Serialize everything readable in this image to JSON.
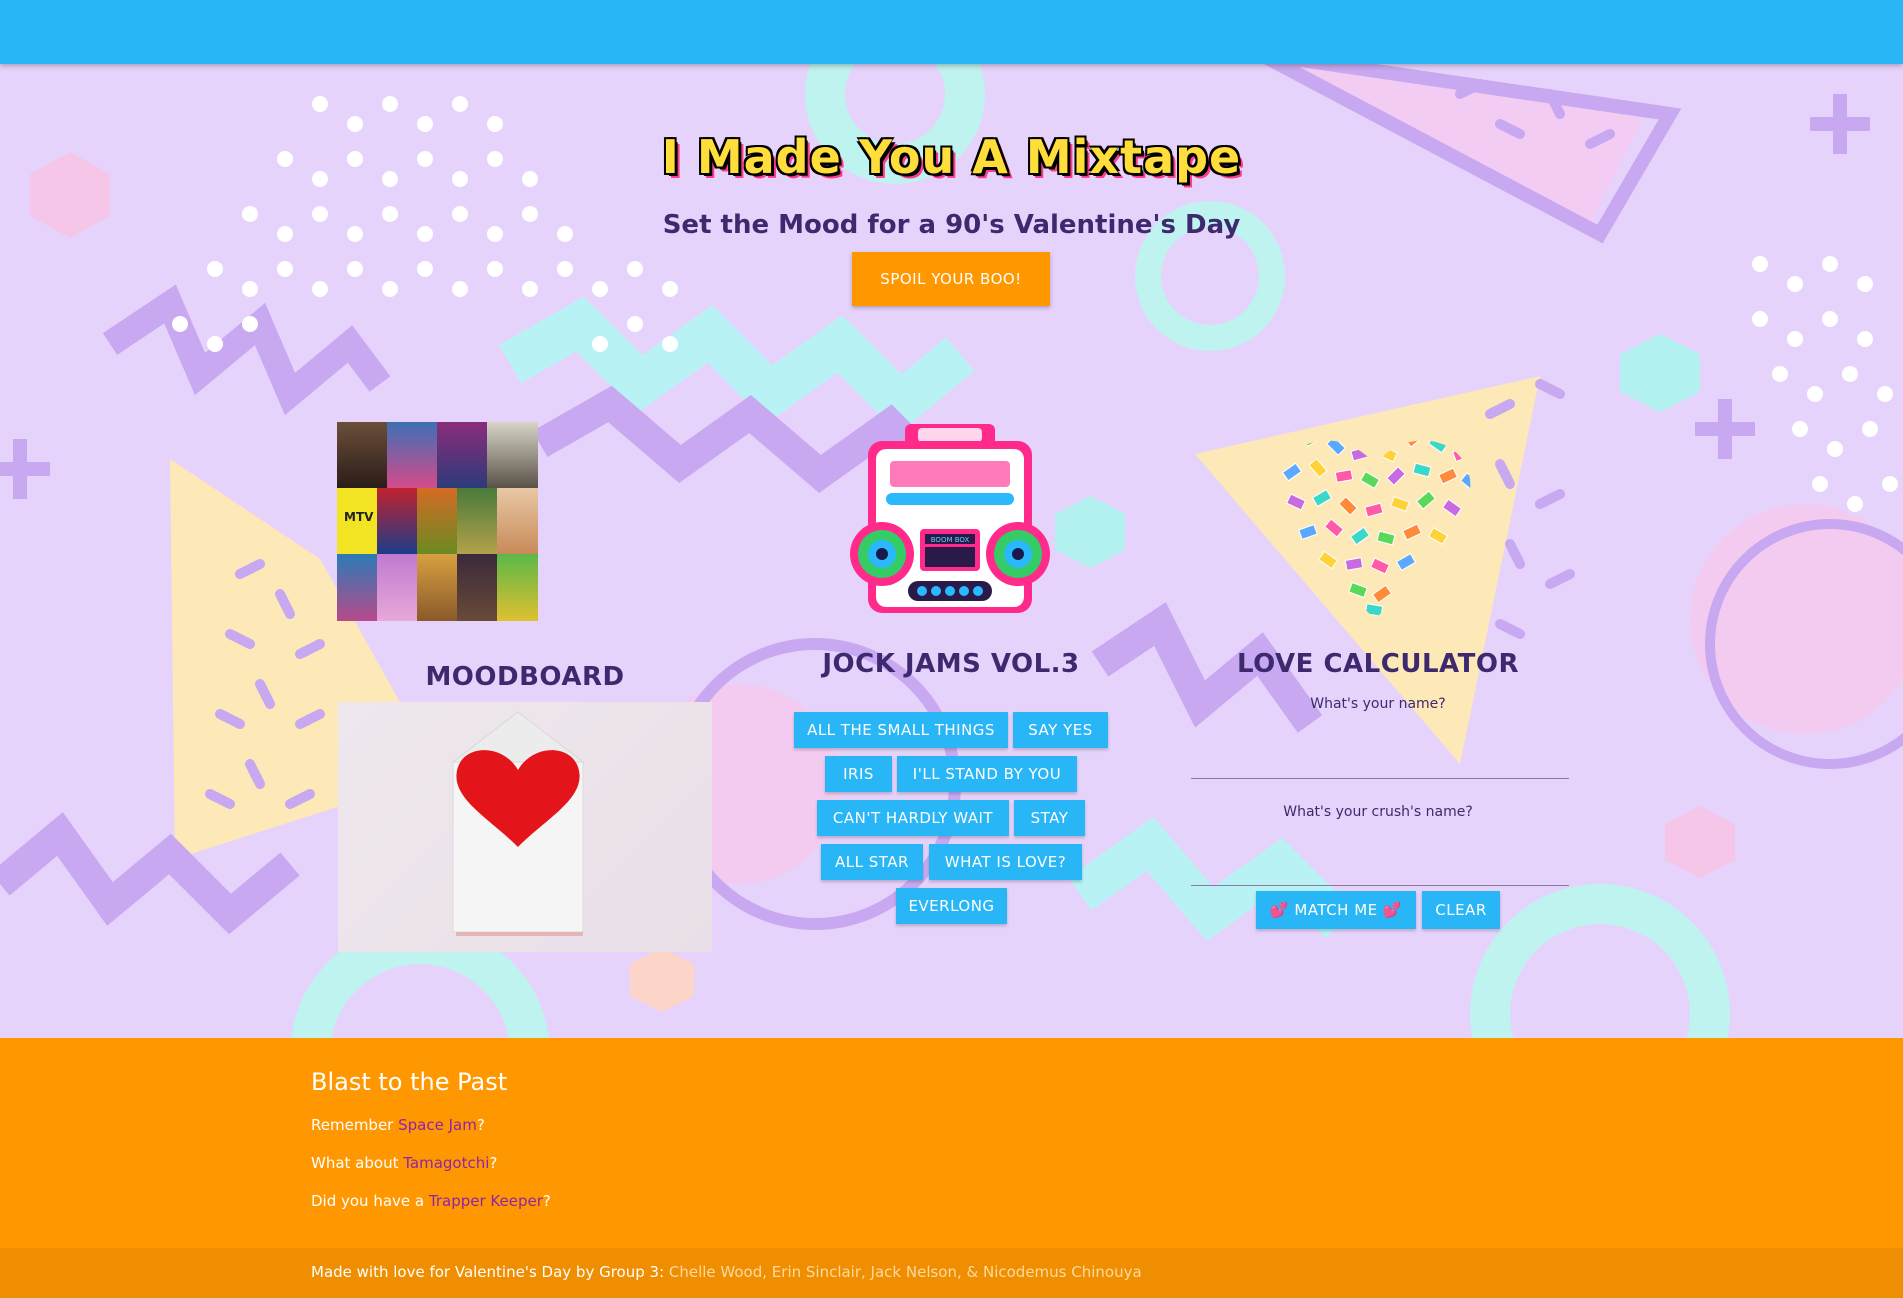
{
  "header": {
    "title": "I Made You A Mixtape",
    "subtitle": "Set the Mood for a 90's Valentine's Day",
    "cta_label": "SPOIL YOUR BOO!"
  },
  "moodboard": {
    "title": "MOODBOARD",
    "collage_label": "MTV"
  },
  "jockjams": {
    "title": "JOCK JAMS VOL.3",
    "boombox_display": "BOOM BOX",
    "songs": [
      "ALL THE SMALL THINGS",
      "SAY YES",
      "IRIS",
      "I'LL STAND BY YOU",
      "CAN'T HARDLY WAIT",
      "STAY",
      "ALL STAR",
      "WHAT IS LOVE?",
      "EVERLONG"
    ]
  },
  "calculator": {
    "title": "LOVE CALCULATOR",
    "name_label": "What's your name?",
    "crush_label": "What's your crush's name?",
    "name_value": "",
    "crush_value": "",
    "match_label": "💕 MATCH ME 💕",
    "clear_label": "CLEAR"
  },
  "footer": {
    "heading": "Blast to the Past",
    "line1_prefix": "Remember ",
    "line1_link": "Space Jam",
    "line1_suffix": "?",
    "line2_prefix": "What about ",
    "line2_link": "Tamagotchi",
    "line2_suffix": "?",
    "line3_prefix": "Did you have a ",
    "line3_link": "Trapper Keeper",
    "line3_suffix": "?"
  },
  "copyright": {
    "prefix": "Made with love for Valentine's Day by Group 3: ",
    "names": "Chelle Wood, Erin Sinclair, Jack Nelson, & Nicodemus Chinouya"
  },
  "colors": {
    "topbar": "#29b6f6",
    "background": "#e6d3fb",
    "cta": "#ff9800",
    "button": "#29b6f6",
    "footer": "#ff9800",
    "link": "#8e24aa"
  }
}
